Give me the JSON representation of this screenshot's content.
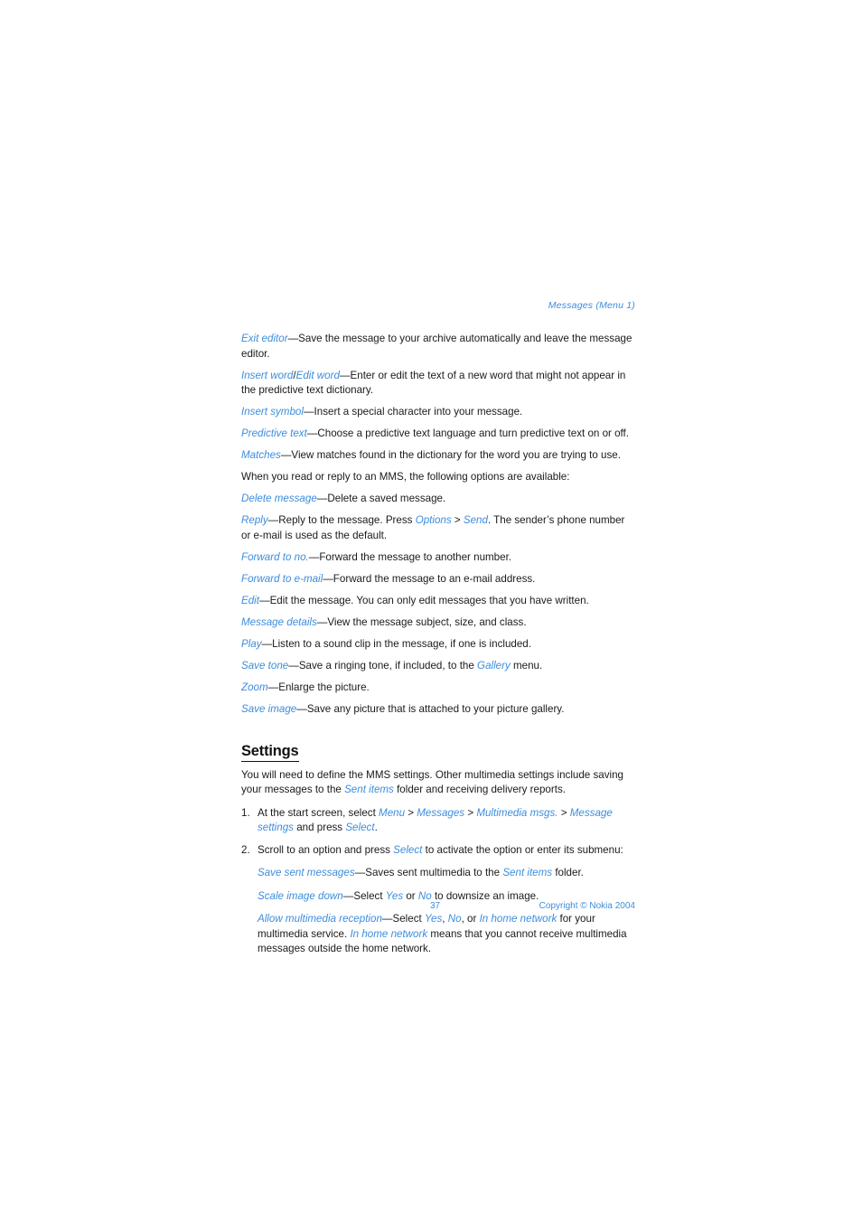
{
  "running_head": "Messages (Menu 1)",
  "paragraphs": [
    {
      "id": "exit-editor",
      "parts": [
        {
          "t": "term",
          "v": "Exit editor"
        },
        {
          "t": "plain",
          "v": "—Save the message to your archive automatically and leave the message editor."
        }
      ]
    },
    {
      "id": "insert-word",
      "parts": [
        {
          "t": "term",
          "v": "Insert word"
        },
        {
          "t": "plain",
          "v": "/"
        },
        {
          "t": "term",
          "v": "Edit word"
        },
        {
          "t": "plain",
          "v": "—Enter or edit the text of a new word that might not appear in the predictive text dictionary."
        }
      ]
    },
    {
      "id": "insert-symbol",
      "parts": [
        {
          "t": "term",
          "v": "Insert symbol"
        },
        {
          "t": "plain",
          "v": "—Insert a special character into your message."
        }
      ]
    },
    {
      "id": "predictive-text",
      "parts": [
        {
          "t": "term",
          "v": "Predictive text"
        },
        {
          "t": "plain",
          "v": "—Choose a predictive text language and turn predictive text on or off."
        }
      ]
    },
    {
      "id": "matches",
      "parts": [
        {
          "t": "term",
          "v": "Matches"
        },
        {
          "t": "plain",
          "v": "—View matches found in the dictionary for the word you are trying to use."
        }
      ]
    },
    {
      "id": "mms-intro",
      "parts": [
        {
          "t": "plain",
          "v": "When you read or reply to an MMS, the following options are available:"
        }
      ]
    },
    {
      "id": "delete-message",
      "parts": [
        {
          "t": "term",
          "v": "Delete message"
        },
        {
          "t": "plain",
          "v": "—Delete a saved message."
        }
      ]
    },
    {
      "id": "reply",
      "parts": [
        {
          "t": "term",
          "v": "Reply"
        },
        {
          "t": "plain",
          "v": "—Reply to the message. Press "
        },
        {
          "t": "term",
          "v": "Options"
        },
        {
          "t": "plain",
          "v": " > "
        },
        {
          "t": "term",
          "v": "Send"
        },
        {
          "t": "plain",
          "v": ". The sender’s phone number or e-mail is used as the default."
        }
      ]
    },
    {
      "id": "forward-to-no",
      "parts": [
        {
          "t": "term",
          "v": "Forward to no."
        },
        {
          "t": "plain",
          "v": "—Forward the message to another number."
        }
      ]
    },
    {
      "id": "forward-to-email",
      "parts": [
        {
          "t": "term",
          "v": "Forward to e-mail"
        },
        {
          "t": "plain",
          "v": "—Forward the message to an e-mail address."
        }
      ]
    },
    {
      "id": "edit",
      "parts": [
        {
          "t": "term",
          "v": "Edit"
        },
        {
          "t": "plain",
          "v": "—Edit the message. You can only edit messages that you have written."
        }
      ]
    },
    {
      "id": "message-details",
      "parts": [
        {
          "t": "term",
          "v": "Message details"
        },
        {
          "t": "plain",
          "v": "—View the message subject, size, and class."
        }
      ]
    },
    {
      "id": "play",
      "parts": [
        {
          "t": "term",
          "v": "Play"
        },
        {
          "t": "plain",
          "v": "—Listen to a sound clip in the message, if one is included."
        }
      ]
    },
    {
      "id": "save-tone",
      "parts": [
        {
          "t": "term",
          "v": "Save tone"
        },
        {
          "t": "plain",
          "v": "—Save a ringing tone, if included, to the "
        },
        {
          "t": "term",
          "v": "Gallery"
        },
        {
          "t": "plain",
          "v": " menu."
        }
      ]
    },
    {
      "id": "zoom",
      "parts": [
        {
          "t": "term",
          "v": "Zoom"
        },
        {
          "t": "plain",
          "v": "—Enlarge the picture."
        }
      ]
    },
    {
      "id": "save-image",
      "parts": [
        {
          "t": "term",
          "v": "Save image"
        },
        {
          "t": "plain",
          "v": "—Save any picture that is attached to your picture gallery."
        }
      ]
    }
  ],
  "settings_section": {
    "heading": "Settings",
    "intro_parts": [
      {
        "t": "plain",
        "v": "You will need to define the MMS settings. Other multimedia settings include saving your messages to the "
      },
      {
        "t": "term",
        "v": "Sent items"
      },
      {
        "t": "plain",
        "v": " folder and receiving delivery reports."
      }
    ],
    "steps": [
      {
        "id": "step-1",
        "number": "1.",
        "parts": [
          {
            "t": "plain",
            "v": "At the start screen, select "
          },
          {
            "t": "term",
            "v": "Menu"
          },
          {
            "t": "plain",
            "v": " > "
          },
          {
            "t": "term",
            "v": "Messages"
          },
          {
            "t": "plain",
            "v": " > "
          },
          {
            "t": "term",
            "v": "Multimedia msgs."
          },
          {
            "t": "plain",
            "v": " > "
          },
          {
            "t": "term",
            "v": "Message settings"
          },
          {
            "t": "plain",
            "v": " and press "
          },
          {
            "t": "term",
            "v": "Select"
          },
          {
            "t": "plain",
            "v": "."
          }
        ],
        "substeps": []
      },
      {
        "id": "step-2",
        "number": "2.",
        "parts": [
          {
            "t": "plain",
            "v": "Scroll to an option and press "
          },
          {
            "t": "term",
            "v": "Select"
          },
          {
            "t": "plain",
            "v": " to activate the option or enter its submenu:"
          }
        ],
        "substeps": [
          {
            "id": "save-sent-messages",
            "parts": [
              {
                "t": "term",
                "v": "Save sent messages"
              },
              {
                "t": "plain",
                "v": "—Saves sent multimedia to the "
              },
              {
                "t": "term",
                "v": "Sent items"
              },
              {
                "t": "plain",
                "v": " folder."
              }
            ]
          },
          {
            "id": "scale-image-down",
            "parts": [
              {
                "t": "term",
                "v": "Scale image down"
              },
              {
                "t": "plain",
                "v": "—Select "
              },
              {
                "t": "term",
                "v": "Yes"
              },
              {
                "t": "plain",
                "v": " or "
              },
              {
                "t": "term",
                "v": "No"
              },
              {
                "t": "plain",
                "v": " to downsize an image."
              }
            ]
          },
          {
            "id": "allow-multimedia-reception",
            "parts": [
              {
                "t": "term",
                "v": "Allow multimedia reception"
              },
              {
                "t": "plain",
                "v": "—Select "
              },
              {
                "t": "term",
                "v": "Yes"
              },
              {
                "t": "plain",
                "v": ", "
              },
              {
                "t": "term",
                "v": "No"
              },
              {
                "t": "plain",
                "v": ", or "
              },
              {
                "t": "term",
                "v": "In home network"
              },
              {
                "t": "plain",
                "v": " for your multimedia service. "
              },
              {
                "t": "term",
                "v": "In home network"
              },
              {
                "t": "plain",
                "v": " means that you cannot receive multimedia messages outside the home network."
              }
            ]
          }
        ]
      }
    ]
  },
  "footer": {
    "page_number": "37",
    "copyright": "Copyright © Nokia 2004"
  },
  "colors": {
    "accent_blue": "#3c8ddc",
    "body_text": "#1a1a1a"
  }
}
